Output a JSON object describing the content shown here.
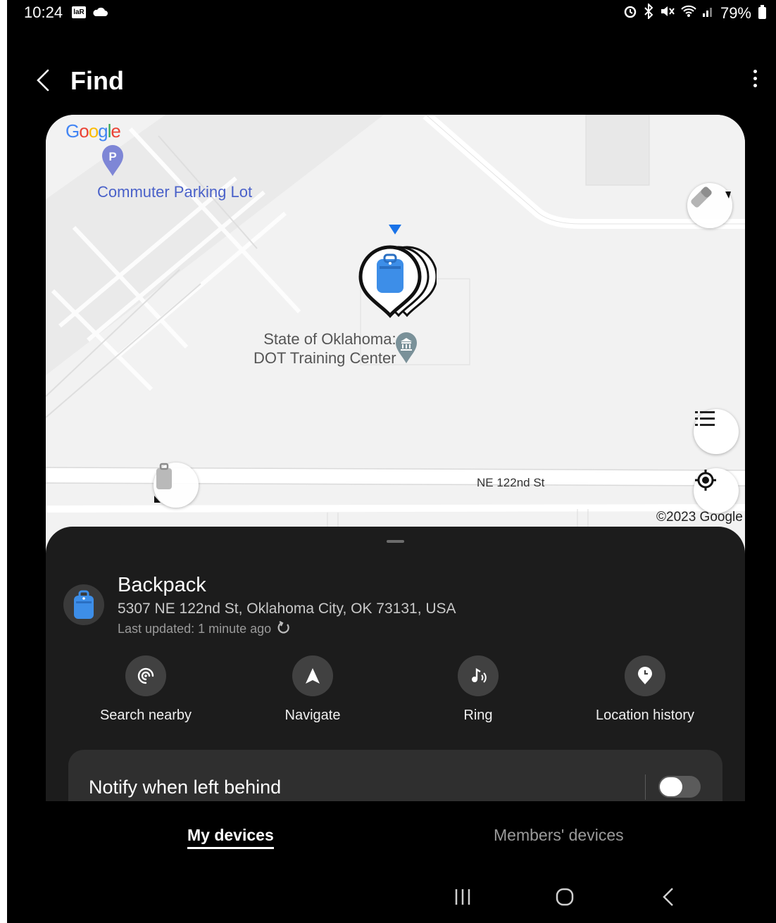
{
  "status_bar": {
    "time": "10:24",
    "badge": "laR",
    "battery": "79%"
  },
  "app_bar": {
    "title": "Find"
  },
  "map": {
    "provider": "Google",
    "labels": {
      "parking": "Commuter Parking Lot",
      "place_line1": "State of Oklahoma:",
      "place_line2": "DOT Training Center",
      "street": "NE 122nd St",
      "copyright": "©2023 Google"
    },
    "pin_icon": "backpack-icon",
    "other_device_icon": "luggage-icon"
  },
  "device": {
    "name": "Backpack",
    "address": "5307 NE 122nd St, Oklahoma City, OK 73131, USA",
    "updated": "Last updated: 1 minute ago",
    "accent_color": "#3d8ee8"
  },
  "actions": [
    {
      "label": "Search nearby",
      "icon": "search-nearby-icon"
    },
    {
      "label": "Navigate",
      "icon": "navigate-icon"
    },
    {
      "label": "Ring",
      "icon": "ring-icon"
    },
    {
      "label": "Location history",
      "icon": "location-history-icon"
    }
  ],
  "notify": {
    "label": "Notify when left behind",
    "enabled": false
  },
  "tabs": {
    "my_devices": "My devices",
    "members_devices": "Members' devices"
  }
}
